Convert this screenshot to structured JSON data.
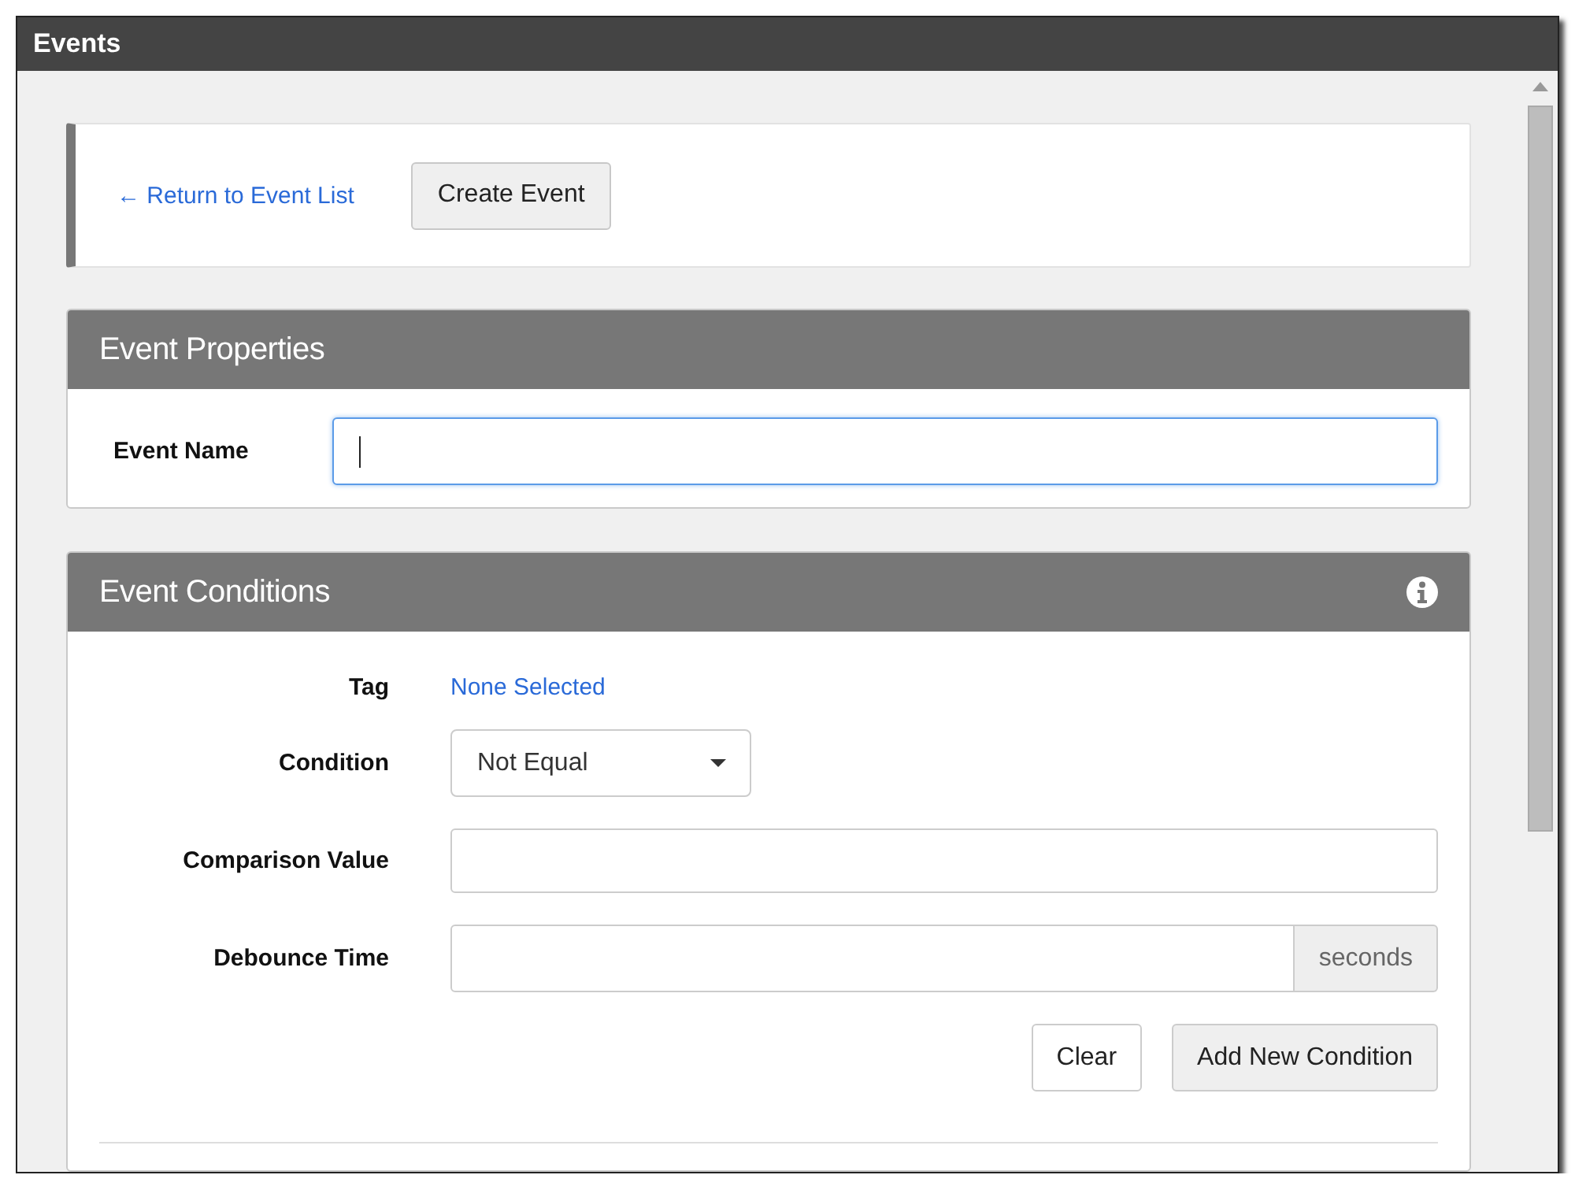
{
  "window": {
    "title": "Events"
  },
  "toolbar": {
    "back_link": "← Return to Event List",
    "create_button": "Create Event"
  },
  "panels": [
    {
      "title": "Event Properties",
      "info_icon": false,
      "rows": [
        {
          "kind": "input",
          "label": "Event Name",
          "focused": true
        }
      ]
    },
    {
      "title": "Event Conditions",
      "info_icon": true,
      "rows": [
        {
          "kind": "link",
          "label": "Tag",
          "value": "None Selected"
        },
        {
          "kind": "select",
          "label": "Condition",
          "value": "Not Equal"
        },
        {
          "kind": "input",
          "label": "Comparison Value",
          "focused": false
        },
        {
          "kind": "input_addon",
          "label": "Debounce Time",
          "addon": "seconds",
          "focused": false
        }
      ],
      "buttons": [
        {
          "label": "Clear",
          "kind": "plain"
        },
        {
          "label": "Add New Condition",
          "kind": "filled"
        }
      ]
    }
  ]
}
